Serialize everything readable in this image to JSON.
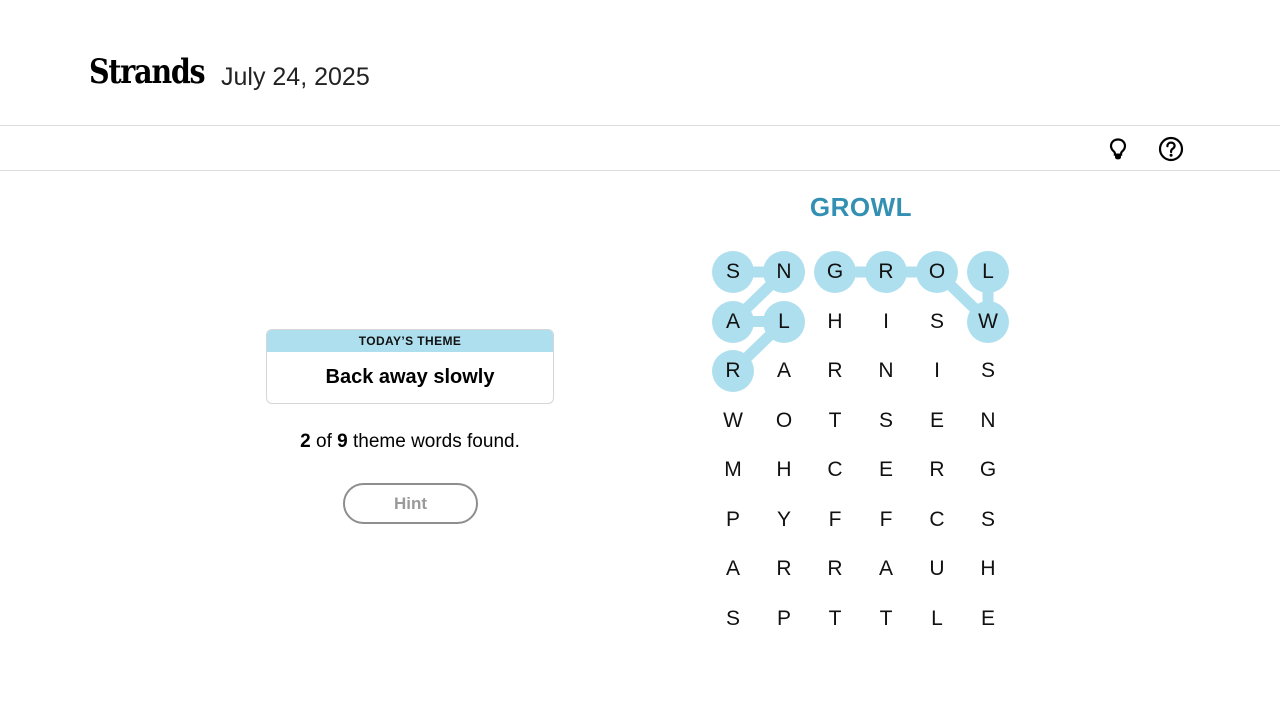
{
  "header": {
    "logo": "Strands",
    "date": "July 24, 2025"
  },
  "toolbar": {
    "icons": [
      "lightbulb-icon",
      "help-circle-icon"
    ]
  },
  "theme": {
    "label": "TODAY’S THEME",
    "text": "Back away slowly"
  },
  "progress": {
    "found": "2",
    "of_text": " of ",
    "total": "9",
    "suffix": " theme words found."
  },
  "hint_button": {
    "label": "Hint"
  },
  "current_word": "GROWL",
  "colors": {
    "highlight": "#aedfee",
    "accent_text": "#3490b2",
    "border": "#dcdcdc"
  },
  "grid": {
    "rows": [
      [
        "S",
        "N",
        "G",
        "R",
        "O",
        "L"
      ],
      [
        "A",
        "L",
        "H",
        "I",
        "S",
        "W"
      ],
      [
        "R",
        "A",
        "R",
        "N",
        "I",
        "S"
      ],
      [
        "W",
        "O",
        "T",
        "S",
        "E",
        "N"
      ],
      [
        "M",
        "H",
        "C",
        "E",
        "R",
        "G"
      ],
      [
        "P",
        "Y",
        "F",
        "F",
        "C",
        "S"
      ],
      [
        "A",
        "R",
        "R",
        "A",
        "U",
        "H"
      ],
      [
        "S",
        "P",
        "T",
        "T",
        "L",
        "E"
      ]
    ],
    "found_paths": [
      [
        [
          0,
          0
        ],
        [
          0,
          1
        ],
        [
          1,
          0
        ],
        [
          1,
          1
        ],
        [
          2,
          0
        ]
      ],
      [
        [
          0,
          2
        ],
        [
          0,
          3
        ],
        [
          0,
          4
        ],
        [
          1,
          5
        ],
        [
          0,
          5
        ]
      ]
    ]
  }
}
